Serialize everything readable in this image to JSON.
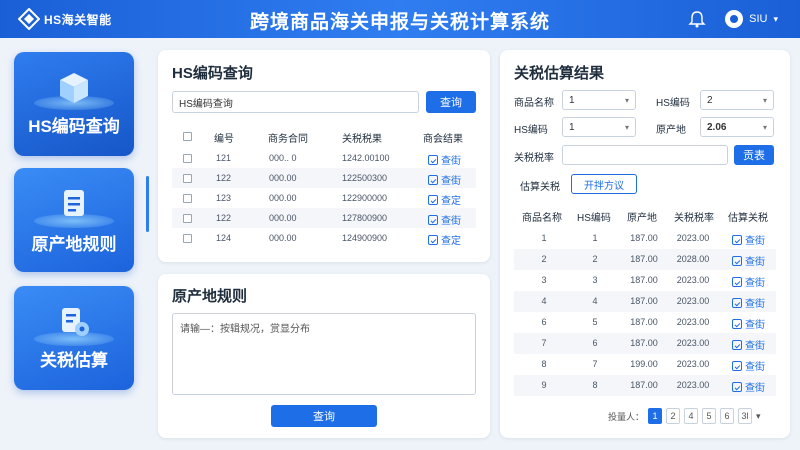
{
  "header": {
    "logo_text": "HS海关智能",
    "title": "跨境商品海关申报与关税计算系统",
    "user": "SIU"
  },
  "nav": [
    {
      "label": "HS编码查询",
      "icon": "cube-icon"
    },
    {
      "label": "原产地规则",
      "icon": "document-icon"
    },
    {
      "label": "关税估算",
      "icon": "file-gear-icon"
    }
  ],
  "hs_panel": {
    "title": "HS编码查询",
    "search_value": "HS编码查询",
    "search_button": "查询",
    "columns": [
      "编号",
      "商务合同",
      "关税税果",
      "商会结果"
    ],
    "rows": [
      {
        "id": "121",
        "contract": "000.. 0",
        "tax": "1242.00100",
        "action": "查街"
      },
      {
        "id": "122",
        "contract": "000.00",
        "tax": "122500300",
        "action": "查街"
      },
      {
        "id": "123",
        "contract": "000.00",
        "tax": "122900000",
        "action": "查定"
      },
      {
        "id": "122",
        "contract": "000.00",
        "tax": "127800900",
        "action": "查街"
      },
      {
        "id": "124",
        "contract": "000.00",
        "tax": "124900900",
        "action": "查定"
      }
    ]
  },
  "origin_panel": {
    "title": "原产地规则",
    "placeholder": "请输—：按辑规况，赏显分布",
    "button": "查询"
  },
  "tax_panel": {
    "title": "关税估算结果",
    "fields": {
      "name_label": "商品名称",
      "name_value": "1",
      "hs_label": "HS编码",
      "hs_value": "2",
      "hs2_label": "HS编码",
      "hs2_value": "1",
      "origin_label": "原产地",
      "origin_value": "2.06",
      "rate_label": "关税税率",
      "rate_value": "",
      "rate_button": "贡表",
      "est_label": "估算关税",
      "est_button": "开拌方议"
    },
    "columns": [
      "商品名称",
      "HS编码",
      "原产地",
      "关税税率",
      "估算关税"
    ],
    "rows": [
      {
        "name": "1",
        "hs": "1",
        "origin": "187.00",
        "rate": "2023.00",
        "action": "查街"
      },
      {
        "name": "2",
        "hs": "2",
        "origin": "187.00",
        "rate": "2028.00",
        "action": "查街"
      },
      {
        "name": "3",
        "hs": "3",
        "origin": "187.00",
        "rate": "2023.00",
        "action": "查街"
      },
      {
        "name": "4",
        "hs": "4",
        "origin": "187.00",
        "rate": "2023.00",
        "action": "查街"
      },
      {
        "name": "6",
        "hs": "5",
        "origin": "187.00",
        "rate": "2023.00",
        "action": "查街"
      },
      {
        "name": "7",
        "hs": "6",
        "origin": "187.00",
        "rate": "2023.00",
        "action": "查街"
      },
      {
        "name": "8",
        "hs": "7",
        "origin": "199.00",
        "rate": "2023.00",
        "action": "查街"
      },
      {
        "name": "9",
        "hs": "8",
        "origin": "187.00",
        "rate": "2023.00",
        "action": "查街"
      }
    ],
    "pager_label": "投量人：",
    "pages": [
      "1",
      "2",
      "4",
      "5",
      "6",
      "3l"
    ]
  },
  "colors": {
    "accent": "#1e6ee8",
    "header": "#1a5fd6"
  }
}
